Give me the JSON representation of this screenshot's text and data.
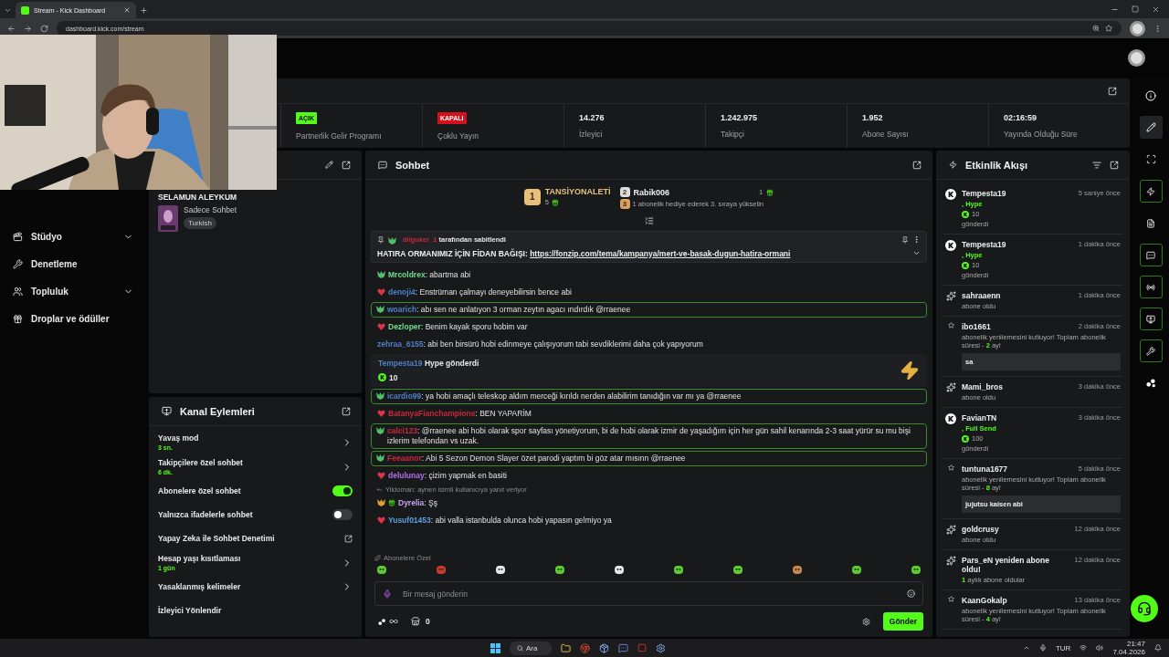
{
  "browser": {
    "tab_title": "Stream - Kick Dashboard",
    "url": "dashboard.kick.com/stream"
  },
  "nav": [
    {
      "label": "Stüdyo",
      "kind": "studio",
      "expandable": true
    },
    {
      "label": "Denetleme",
      "kind": "moderation",
      "expandable": false
    },
    {
      "label": "Topluluk",
      "kind": "community",
      "expandable": true
    },
    {
      "label": "Droplar ve ödüller",
      "kind": "drops",
      "expandable": false
    }
  ],
  "stats": [
    {
      "kind": "badge",
      "badge": "AÇIK",
      "on": true,
      "label": "Partnerlik Gelir Programı"
    },
    {
      "kind": "badge",
      "badge": "KAPALI",
      "on": false,
      "label": "Çoklu Yayın"
    },
    {
      "kind": "number",
      "value": "14.276",
      "label": "İzleyici"
    },
    {
      "kind": "number",
      "value": "1.242.975",
      "label": "Takipçi"
    },
    {
      "kind": "number",
      "value": "1.952",
      "label": "Abone Sayısı"
    },
    {
      "kind": "number",
      "value": "02:16:59",
      "label": "Yayında Olduğu Süre"
    }
  ],
  "stream_info": {
    "title": "SELAMUN ALEYKUM",
    "category": "Sadece Sohbet",
    "tags": [
      "Turkish"
    ]
  },
  "channel_actions": {
    "title": "Kanal Eylemleri",
    "items": [
      {
        "kind": "link",
        "label": "Yavaş mod",
        "value": "3 sn."
      },
      {
        "kind": "link",
        "label": "Takipçilere özel sohbet",
        "value": "6 dk."
      },
      {
        "kind": "toggle",
        "label": "Abonelere özel sohbet",
        "on": true
      },
      {
        "kind": "toggle",
        "label": "Yalnızca ifadelerle sohbet",
        "on": false
      },
      {
        "kind": "external",
        "label": "Yapay Zeka ile Sohbet Denetimi"
      },
      {
        "kind": "link",
        "label": "Hesap yaşı kısıtlaması",
        "value": "1 gün"
      },
      {
        "kind": "link",
        "label": "Yasaklanmış kelimeler"
      },
      {
        "kind": "plain",
        "label": "İzleyici Yönlendir"
      }
    ]
  },
  "chat": {
    "title": "Sohbet",
    "leaders": [
      {
        "rank": "1",
        "name": "TANSİYONALETİ",
        "gifts": "5"
      },
      {
        "rank": "2",
        "name": "Rabik006",
        "gifts": "1"
      }
    ],
    "leader_hint": {
      "rank": "3",
      "text": "1 abonelik hediye ederek 3. sıraya yükselin"
    },
    "pinned": {
      "user": "dilguker_1",
      "label": "tarafından sabitlendi",
      "text": "HATIRA ORMANIMIZ İÇİN FİDAN BAĞIŞI: ",
      "link": "https://fonzip.com/tema/kampanya/mert-ve-basak-dugun-hatira-ormani"
    },
    "messages": [
      {
        "kind": "message",
        "user": "Mrcoldrex",
        "color": "#6fdc8c",
        "badge": {
          "kind": "wolf"
        },
        "gift_badge": false,
        "text": ": abartma abi",
        "highlighted": false
      },
      {
        "kind": "message",
        "user": "denoji4",
        "color": "#4f7fc8",
        "badge": {
          "kind": "heart"
        },
        "gift_badge": false,
        "text": ": Enstrüman çalmayı deneyebilirsin bence abi",
        "highlighted": false
      },
      {
        "kind": "message",
        "user": "woarich",
        "color": "#4f7fc8",
        "badge": {
          "kind": "wolf"
        },
        "gift_badge": false,
        "text": ": abı sen ne anlatıyon 3 orman zeytın agacı ındırdık @rraenee",
        "highlighted": true
      },
      {
        "kind": "message",
        "user": "Dezloper",
        "color": "#6fdc8c",
        "badge": {
          "kind": "heart"
        },
        "gift_badge": false,
        "text": ": Benim kayak sporu hobim var",
        "highlighted": false
      },
      {
        "kind": "message",
        "user": "zehraa_6155",
        "color": "#4f7fc8",
        "gift_badge": false,
        "text": ": abi ben birsürü hobi edinmeye çalışıyorum tabi sevdiklerimi daha çok yapıyorum",
        "highlighted": false
      },
      {
        "kind": "hype",
        "user": "Tempesta19",
        "color": "#4f7fc8",
        "text": "Hype gönderdi",
        "amount": "10"
      },
      {
        "kind": "message",
        "user": "icardio99",
        "color": "#4f7fc8",
        "badge": {
          "kind": "wolf"
        },
        "gift_badge": false,
        "text": ": ya hobi amaçlı teleskop aldım merceği kırıldı nerden alabilirim tanıdığın var mı ya @rraenee",
        "highlighted": true
      },
      {
        "kind": "message",
        "user": "BatanyaFianchampions",
        "color": "#c8283c",
        "badge": {
          "kind": "heart"
        },
        "gift_badge": false,
        "text": ": BEN YAPARİM",
        "highlighted": false
      },
      {
        "kind": "message",
        "user": "calci123",
        "color": "#c8283c",
        "badge": {
          "kind": "wolf"
        },
        "gift_badge": false,
        "text": ": @rraenee abi hobi olarak spor sayfası yönetiyorum, bi de hobi olarak izmir de yaşadığım için her gün sahil kenarında 2-3 saat yürür su mu bişi izlerim telefondan vs uzak.",
        "highlighted": true
      },
      {
        "kind": "message",
        "user": "Feeaanor",
        "color": "#c8283c",
        "badge": {
          "kind": "wolf"
        },
        "gift_badge": false,
        "text": ": Abi 5 Sezon Demon Slayer özet parodi yaptım bi göz atar mısınn @rraenee",
        "highlighted": true
      },
      {
        "kind": "message",
        "user": "delulunay",
        "color": "#b36ee8",
        "badge": {
          "kind": "heart"
        },
        "gift_badge": false,
        "text": ": çizim yapmak en basiti",
        "highlighted": false
      },
      {
        "kind": "message",
        "user": "Dyrelia",
        "color": "#c9a0f0",
        "badge": {
          "kind": "gold"
        },
        "gift_badge": true,
        "reply_to": "Yildoman: aynen isimli kullanıcıya yanıt veriyor",
        "text": ": Şş",
        "highlighted": false
      },
      {
        "kind": "message",
        "user": "Yusuf01453",
        "color": "#5aa0e6",
        "badge": {
          "kind": "heart"
        },
        "gift_badge": false,
        "text": ": abi valla istanbulda olunca hobi yapasın gelmiyo ya",
        "highlighted": false
      }
    ],
    "emotes_label": "Abonelere Özel",
    "input": {
      "placeholder": "Bir mesaj gönderin"
    },
    "store_count": "0",
    "send": "Gönder"
  },
  "activity": {
    "title": "Etkinlik Akışı",
    "events": [
      {
        "kind": "hype",
        "user": "Tempesta19",
        "time": "5 saniye önce",
        "item": ", Hype",
        "amount": "10",
        "action": "gönderdi"
      },
      {
        "kind": "hype",
        "user": "Tempesta19",
        "time": "1 dakika önce",
        "item": ", Hype",
        "amount": "10",
        "action": "gönderdi"
      },
      {
        "kind": "sub",
        "user": "sahraaenn",
        "time": "1 dakika önce",
        "action": "abone oldu"
      },
      {
        "kind": "resub",
        "user": "ibo1661",
        "time": "2 dakika önce",
        "detail": "abonelik yenilemesini kutluyor! Toplam abonelik süresi - ",
        "months": "2",
        "detail_end": " ay!",
        "message": "sa"
      },
      {
        "kind": "sub",
        "user": "Mami_bros",
        "time": "3 dakika önce",
        "action": "abone oldu"
      },
      {
        "kind": "hype",
        "user": "FavianTN",
        "time": "3 dakika önce",
        "item": ", Full Send",
        "amount": "100",
        "action": "gönderdi"
      },
      {
        "kind": "resub",
        "user": "tuntuna1677",
        "time": "5 dakika önce",
        "detail": "abonelik yenilemesini kutluyor! Toplam abonelik süresi - ",
        "months": "8",
        "detail_end": " ay!",
        "message": "jujutsu kaisen abi"
      },
      {
        "kind": "sub",
        "user": "goldcrusy",
        "time": "12 dakika önce",
        "action": "abone oldu"
      },
      {
        "kind": "sub_months",
        "user": "Pars_eN yeniden abone oldu!",
        "time": "12 dakika önce",
        "months": "1",
        "detail_end": " aylık abone oldular"
      },
      {
        "kind": "resub",
        "user": "KaanGokalp",
        "time": "13 dakika önce",
        "detail": "abonelik yenilemesini kutluyor! Toplam abonelik süresi - ",
        "months": "4",
        "detail_end": " ay!"
      }
    ]
  },
  "rail": [
    {
      "kind": "info",
      "active": false,
      "selected": false
    },
    {
      "kind": "edit",
      "active": false,
      "selected": true
    },
    {
      "kind": "focus",
      "active": false,
      "selected": false
    },
    {
      "kind": "events",
      "active": true,
      "selected": false
    },
    {
      "kind": "notes",
      "active": false,
      "selected": false
    },
    {
      "kind": "chat",
      "active": true,
      "selected": false
    },
    {
      "kind": "broadcast",
      "active": true,
      "selected": false
    },
    {
      "kind": "actions",
      "active": true,
      "selected": false
    },
    {
      "kind": "tools",
      "active": true,
      "selected": false
    },
    {
      "kind": "apps",
      "active": false,
      "selected": false
    }
  ],
  "taskbar": {
    "search": "Ara",
    "language": "TUR",
    "time": "21:47",
    "date": "7.04.2026"
  }
}
